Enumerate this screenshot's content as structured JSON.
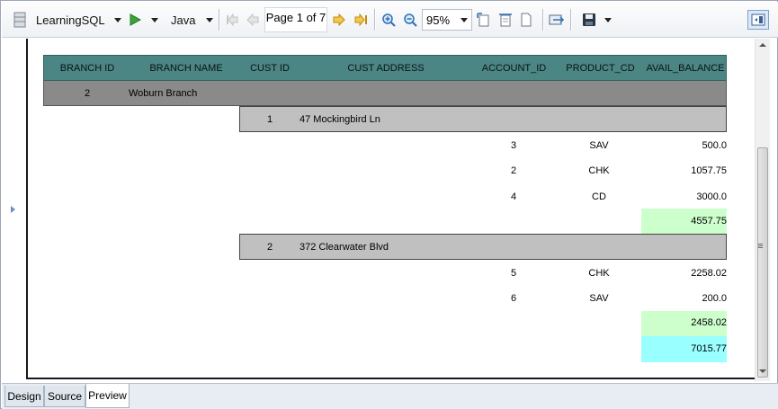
{
  "toolbar": {
    "datasource": "LearningSQL",
    "language": "Java",
    "page_indicator": "Page 1 of 7",
    "zoom": "95%"
  },
  "report": {
    "columns": [
      "BRANCH ID",
      "BRANCH NAME",
      "CUST ID",
      "CUST ADDRESS",
      "ACCOUNT_ID",
      "PRODUCT_CD",
      "AVAIL_BALANCE"
    ],
    "branch": {
      "id": "2",
      "name": "Woburn Branch"
    },
    "customers": [
      {
        "cust_id": "1",
        "address": "47 Mockingbird Ln",
        "accounts": [
          {
            "account_id": "3",
            "product_cd": "SAV",
            "balance": "500.0"
          },
          {
            "account_id": "2",
            "product_cd": "CHK",
            "balance": "1057.75"
          },
          {
            "account_id": "4",
            "product_cd": "CD",
            "balance": "3000.0"
          }
        ],
        "subtotal": "4557.75"
      },
      {
        "cust_id": "2",
        "address": "372 Clearwater Blvd",
        "accounts": [
          {
            "account_id": "5",
            "product_cd": "CHK",
            "balance": "2258.02"
          },
          {
            "account_id": "6",
            "product_cd": "SAV",
            "balance": "200.0"
          }
        ],
        "subtotal": "2458.02"
      }
    ],
    "branch_total": "7015.77"
  },
  "tabs": [
    "Design",
    "Source",
    "Preview"
  ],
  "active_tab": "Preview",
  "colors": {
    "header_bg": "#4b8584",
    "branch_bg": "#8a8a8a",
    "customer_bg": "#c0c0c0",
    "subtotal_bg": "#ccffcc",
    "total_bg": "#99ffff"
  }
}
